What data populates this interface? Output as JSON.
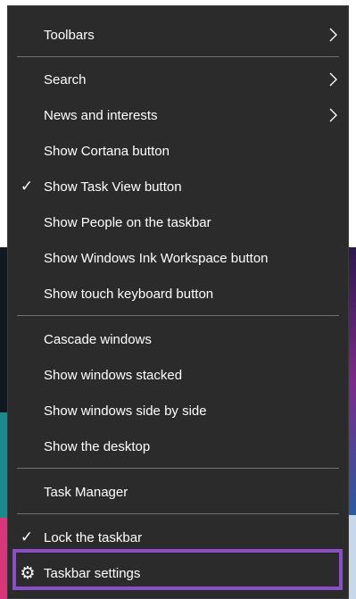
{
  "menu": {
    "items": [
      {
        "label": "Toolbars"
      },
      {
        "label": "Search"
      },
      {
        "label": "News and interests"
      },
      {
        "label": "Show Cortana button"
      },
      {
        "label": "Show Task View button"
      },
      {
        "label": "Show People on the taskbar"
      },
      {
        "label": "Show Windows Ink Workspace button"
      },
      {
        "label": "Show touch keyboard button"
      },
      {
        "label": "Cascade windows"
      },
      {
        "label": "Show windows stacked"
      },
      {
        "label": "Show windows side by side"
      },
      {
        "label": "Show the desktop"
      },
      {
        "label": "Task Manager"
      },
      {
        "label": "Lock the taskbar"
      },
      {
        "label": "Taskbar settings"
      }
    ],
    "check_icon": "check-icon",
    "submenu_icon": "chevron-right-icon",
    "settings_icon": "gear-icon"
  },
  "colors": {
    "menu_background": "#2b2b2b",
    "separator": "#6f6f6f",
    "highlight_border": "#8a4fc8",
    "text": "#ffffff"
  }
}
